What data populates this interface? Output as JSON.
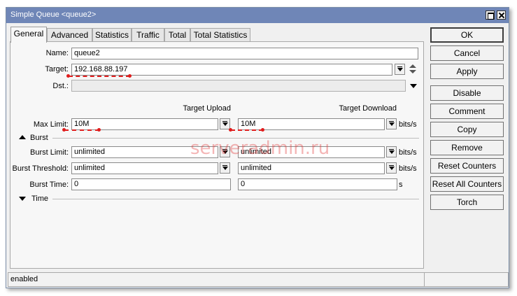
{
  "window": {
    "title": "Simple Queue <queue2>"
  },
  "tabs": [
    {
      "label": "General"
    },
    {
      "label": "Advanced"
    },
    {
      "label": "Statistics"
    },
    {
      "label": "Traffic"
    },
    {
      "label": "Total"
    },
    {
      "label": "Total Statistics"
    }
  ],
  "form": {
    "name_label": "Name:",
    "name_value": "queue2",
    "target_label": "Target:",
    "target_value": "192.168.88.197",
    "dst_label": "Dst.:",
    "dst_value": "",
    "col_upload": "Target Upload",
    "col_download": "Target Download",
    "max_limit_label": "Max Limit:",
    "max_limit_upload": "10M",
    "max_limit_download": "10M",
    "units": "bits/s",
    "burst_section": "Burst",
    "burst_limit_label": "Burst Limit:",
    "burst_limit_upload": "unlimited",
    "burst_limit_download": "unlimited",
    "burst_threshold_label": "Burst Threshold:",
    "burst_threshold_upload": "unlimited",
    "burst_threshold_download": "unlimited",
    "burst_time_label": "Burst Time:",
    "burst_time_upload": "0",
    "burst_time_download": "0",
    "seconds_unit": "s",
    "time_section": "Time"
  },
  "buttons": {
    "ok": "OK",
    "cancel": "Cancel",
    "apply": "Apply",
    "disable": "Disable",
    "comment": "Comment",
    "copy": "Copy",
    "remove": "Remove",
    "reset_counters": "Reset Counters",
    "reset_all_counters": "Reset All Counters",
    "torch": "Torch"
  },
  "status": {
    "text": "enabled"
  },
  "watermark": "serveradmin.ru",
  "colors": {
    "titlebar": "#6f86b7",
    "annotation": "#e01c1c"
  }
}
